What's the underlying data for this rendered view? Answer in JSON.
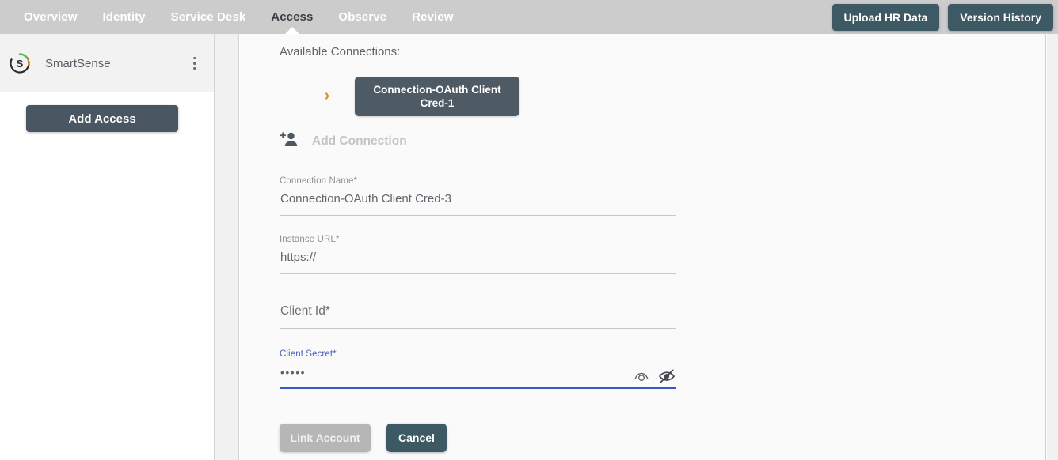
{
  "topbar": {
    "tabs": [
      {
        "label": "Overview",
        "active": false
      },
      {
        "label": "Identity",
        "active": false
      },
      {
        "label": "Service Desk",
        "active": false
      },
      {
        "label": "Access",
        "active": true
      },
      {
        "label": "Observe",
        "active": false
      },
      {
        "label": "Review",
        "active": false
      }
    ],
    "upload_button": "Upload HR Data",
    "version_button": "Version History",
    "bg_color": "#cccccc",
    "button_color": "#3d5964"
  },
  "sidebar": {
    "org_name": "SmartSense",
    "logo_icon": "smartsense-circle-s-logo",
    "menu_icon": "kebab-menu-icon",
    "add_access_button": "Add Access"
  },
  "main": {
    "section_title": "Available Connections:",
    "connections": [
      {
        "expand_icon": "chevron-right-icon",
        "label": "Connection-OAuth Client Cred-1"
      }
    ],
    "add_connection": {
      "icon": "person-add-icon",
      "label": "Add Connection"
    },
    "form": {
      "fields": [
        {
          "name": "connection-name",
          "label": "Connection Name*",
          "value": "Connection-OAuth Client Cred-3",
          "placeholder": "",
          "focused": false
        },
        {
          "name": "instance-url",
          "label": "Instance URL*",
          "value": "https://",
          "placeholder": "",
          "focused": false
        },
        {
          "name": "client-id",
          "label": "",
          "value": "",
          "placeholder": "Client Id*",
          "focused": false
        },
        {
          "name": "client-secret",
          "label": "Client Secret*",
          "value": "•••••",
          "placeholder": "",
          "focused": true
        }
      ],
      "secret_visibility_icon": "eye-icon",
      "secret_visibility_off_icon": "eye-off-icon",
      "link_account_button": "Link Account",
      "cancel_button": "Cancel",
      "focus_color": "#3a56c8",
      "chevron_color": "#d99221"
    }
  }
}
